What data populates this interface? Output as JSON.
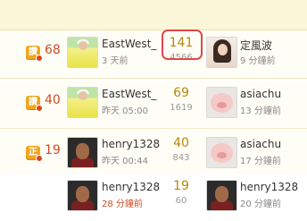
{
  "rows": [
    {
      "badge": "讚",
      "count": "68",
      "author": {
        "avatar": "golfer-avatar",
        "name": "EastWest_",
        "time": "3 天前"
      },
      "replies": "141",
      "views": "4566",
      "last": {
        "avatar": "woman-avatar",
        "name": "定風波",
        "time": "9 分鐘前"
      }
    },
    {
      "badge": "讚",
      "count": "40",
      "author": {
        "avatar": "golfer-avatar",
        "name": "EastWest_",
        "time": "昨天 05:00"
      },
      "replies": "69",
      "views": "1619",
      "last": {
        "avatar": "pig-avatar",
        "name": "asiachu",
        "time": "13 分鐘前"
      }
    },
    {
      "badge": "正",
      "count": "19",
      "author": {
        "avatar": "man-avatar",
        "name": "henry1328",
        "time": "昨天 00:44"
      },
      "replies": "40",
      "views": "843",
      "last": {
        "avatar": "pig-avatar",
        "name": "asiachu",
        "time": "17 分鐘前"
      }
    },
    {
      "author": {
        "avatar": "man-avatar",
        "name": "henry1328",
        "time": "28 分鐘前"
      },
      "replies": "19",
      "views": "60",
      "last": {
        "avatar": "man-avatar",
        "name": "henry1328",
        "time": "20 分鐘前"
      }
    }
  ],
  "colors": {
    "accent": "#cc4c25",
    "badge": "#f2a51d",
    "highlight": "#e04848"
  }
}
